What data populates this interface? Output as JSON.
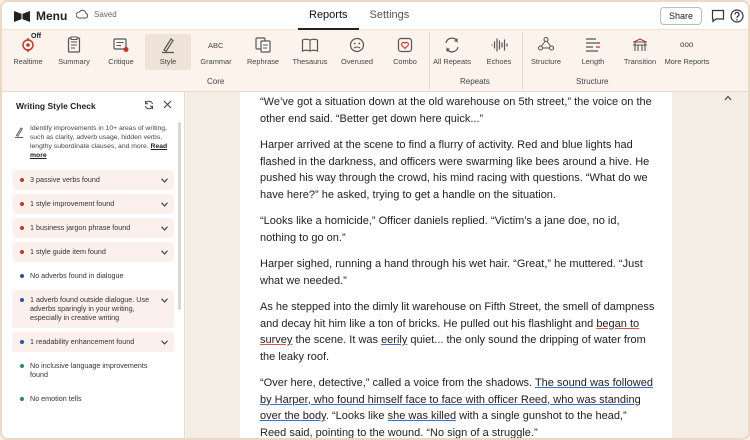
{
  "topbar": {
    "menu_label": "Menu",
    "saved_label": "Saved",
    "tabs": [
      {
        "label": "Reports",
        "active": true
      },
      {
        "label": "Settings",
        "active": false
      }
    ],
    "share_label": "Share"
  },
  "toolbar": {
    "core": {
      "label": "Core",
      "tools": [
        {
          "label": "Realtime",
          "badge": "Off",
          "icon": "realtime-icon"
        },
        {
          "label": "Summary",
          "icon": "summary-icon"
        },
        {
          "label": "Critique",
          "icon": "critique-icon"
        },
        {
          "label": "Style",
          "icon": "style-icon",
          "active": true
        },
        {
          "label": "Grammar",
          "icon": "grammar-icon",
          "glyph": "ABC"
        },
        {
          "label": "Rephrase",
          "icon": "rephrase-icon"
        },
        {
          "label": "Thesaurus",
          "icon": "thesaurus-icon"
        },
        {
          "label": "Overused",
          "icon": "overused-icon"
        },
        {
          "label": "Combo",
          "icon": "combo-icon"
        }
      ]
    },
    "repeats": {
      "label": "Repeats",
      "tools": [
        {
          "label": "All Repeats",
          "icon": "all-repeats-icon"
        },
        {
          "label": "Echoes",
          "icon": "echoes-icon"
        }
      ]
    },
    "structure": {
      "label": "Structure",
      "tools": [
        {
          "label": "Structure",
          "icon": "structure-icon"
        },
        {
          "label": "Length",
          "icon": "length-icon"
        },
        {
          "label": "Transition",
          "icon": "transition-icon"
        },
        {
          "label": "More Reports",
          "icon": "more-reports-icon",
          "glyph": "ooo"
        }
      ]
    }
  },
  "sidebar": {
    "title": "Writing Style Check",
    "intro": "Identify improvements in 10+ areas of writing, such as clarity, adverb usage, hidden verbs, lengthy subordinate clauses, and more.",
    "read_more": "Read more",
    "items": [
      {
        "text": "3 passive verbs found",
        "color": "#c0392b",
        "expandable": true
      },
      {
        "text": "1 style improvement found",
        "color": "#c0392b",
        "expandable": true
      },
      {
        "text": "1 business jargon phrase found",
        "color": "#c0392b",
        "expandable": true
      },
      {
        "text": "1 style guide item found",
        "color": "#c0392b",
        "expandable": true
      },
      {
        "text": "No adverbs found in dialogue",
        "color": "#2b4f9a",
        "expandable": false
      },
      {
        "text": "1 adverb found outside dialogue. Use adverbs sparingly in your writing, especially in creative writing",
        "color": "#2b4f9a",
        "expandable": true
      },
      {
        "text": "1 readability enhancement found",
        "color": "#2b4f9a",
        "expandable": true
      },
      {
        "text": "No inclusive language improvements found",
        "color": "#2e8b57",
        "expandable": false
      },
      {
        "text": "No emotion tells",
        "color": "#2e8b57",
        "expandable": false
      }
    ]
  },
  "document": {
    "p1": "“We’ve got a situation down at the old warehouse on 5th street,” the voice on the other end said. “Better get down here quick...”",
    "p2": "Harper arrived at the scene to find a flurry of activity. Red and blue lights had flashed in the darkness, and officers were swarming like bees around a hive. He pushed his way through the crowd, his mind racing with questions. “What do we have here?” he asked, trying to get a handle on the situation.",
    "p3": "“Looks like a homicide,” Officer daniels replied. “Victim’s a jane doe, no id, nothing to go on.”",
    "p4": "Harper sighed, running a hand through his wet hair. “Great,” he muttered. “Just what we needed.”",
    "p5": {
      "a": "As he stepped into the dimly lit warehouse on Fifth Street, the smell of dampness and decay hit him like a ton of bricks. He pulled out his flashlight and ",
      "b": "began to survey",
      "c": " the scene. It was ",
      "d": "eerily",
      "e": " quiet... the only sound the dripping of water from the leaky roof."
    },
    "p6": {
      "a": "“Over here, detective,” called a voice from the shadows. ",
      "b": "The sound was followed by Harper, who found himself face to face with officer Reed, who was standing over the body",
      "c": ". “Looks like ",
      "d": "she was killed",
      "e": " with a single gunshot to the head,” Reed said, pointing to the wound. “No sign of a struggle.”"
    }
  }
}
